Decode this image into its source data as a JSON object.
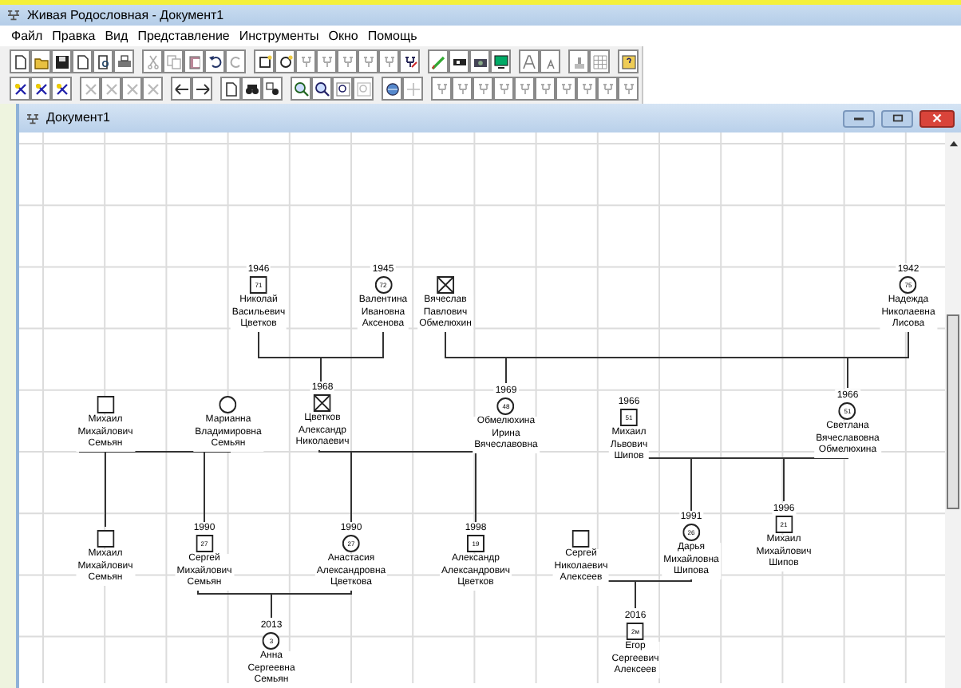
{
  "window": {
    "title": "Живая Родословная - Документ1"
  },
  "menu": [
    "Файл",
    "Правка",
    "Вид",
    "Представление",
    "Инструменты",
    "Окно",
    "Помощь"
  ],
  "document_window": {
    "title": "Документ1"
  },
  "persons": [
    {
      "kind": "male",
      "deceased": false,
      "year": "1946",
      "age": "71",
      "name_lines": [
        "Николай",
        "Васильевич",
        "Цветков"
      ]
    },
    {
      "kind": "female",
      "deceased": false,
      "year": "1945",
      "age": "72",
      "name_lines": [
        "Валентина",
        "Ивановна",
        "Аксенова"
      ]
    },
    {
      "kind": "male",
      "deceased": true,
      "name_lines": [
        "Вячеслав",
        "Павлович",
        "Обмелюхин"
      ]
    },
    {
      "kind": "female",
      "deceased": false,
      "year": "1942",
      "age": "75",
      "name_lines": [
        "Надежда",
        "Николаевна",
        "Лисова"
      ]
    },
    {
      "kind": "male",
      "deceased": false,
      "name_lines": [
        "Михаил",
        "Михайлович",
        "Семьян"
      ]
    },
    {
      "kind": "female",
      "deceased": false,
      "name_lines": [
        "Марианна",
        "Владимировна",
        "Семьян"
      ]
    },
    {
      "kind": "male",
      "deceased": true,
      "year": "1968",
      "name_lines": [
        "Цветков",
        "Александр",
        "Николаевич"
      ]
    },
    {
      "kind": "female",
      "deceased": false,
      "year": "1969",
      "age": "48",
      "name_lines": [
        "Обмелюхина",
        "Ирина",
        "Вячеславовна"
      ]
    },
    {
      "kind": "male",
      "deceased": false,
      "year": "1966",
      "age": "51",
      "name_lines": [
        "Михаил",
        "Львович",
        "Шипов"
      ]
    },
    {
      "kind": "female",
      "deceased": false,
      "year": "1966",
      "age": "51",
      "name_lines": [
        "Светлана",
        "Вячеславовна",
        "Обмелюхина"
      ]
    },
    {
      "kind": "male",
      "deceased": false,
      "name_lines": [
        "Михаил",
        "Михайлович",
        "Семьян"
      ]
    },
    {
      "kind": "male",
      "deceased": false,
      "year": "1990",
      "age": "27",
      "name_lines": [
        "Сергей",
        "Михайлович",
        "Семьян"
      ]
    },
    {
      "kind": "female",
      "deceased": false,
      "year": "1990",
      "age": "27",
      "name_lines": [
        "Анастасия",
        "Александровна",
        "Цветкова"
      ]
    },
    {
      "kind": "male",
      "deceased": false,
      "year": "1998",
      "age": "19",
      "name_lines": [
        "Александр",
        "Александрович",
        "Цветков"
      ]
    },
    {
      "kind": "male",
      "deceased": false,
      "name_lines": [
        "Сергей",
        "Николаевич",
        "Алексеев"
      ]
    },
    {
      "kind": "female",
      "deceased": false,
      "year": "1991",
      "age": "26",
      "name_lines": [
        "Дарья",
        "Михайловна",
        "Шипова"
      ]
    },
    {
      "kind": "male",
      "deceased": false,
      "year": "1996",
      "age": "21",
      "name_lines": [
        "Михаил",
        "Михайлович",
        "Шипов"
      ]
    },
    {
      "kind": "female",
      "deceased": false,
      "year": "2013",
      "age": "3",
      "name_lines": [
        "Анна",
        "Сергеевна",
        "Семьян"
      ]
    },
    {
      "kind": "male",
      "deceased": false,
      "year": "2016",
      "age": "2м",
      "name_lines": [
        "Егор",
        "Сергеевич",
        "Алексеев"
      ]
    }
  ]
}
